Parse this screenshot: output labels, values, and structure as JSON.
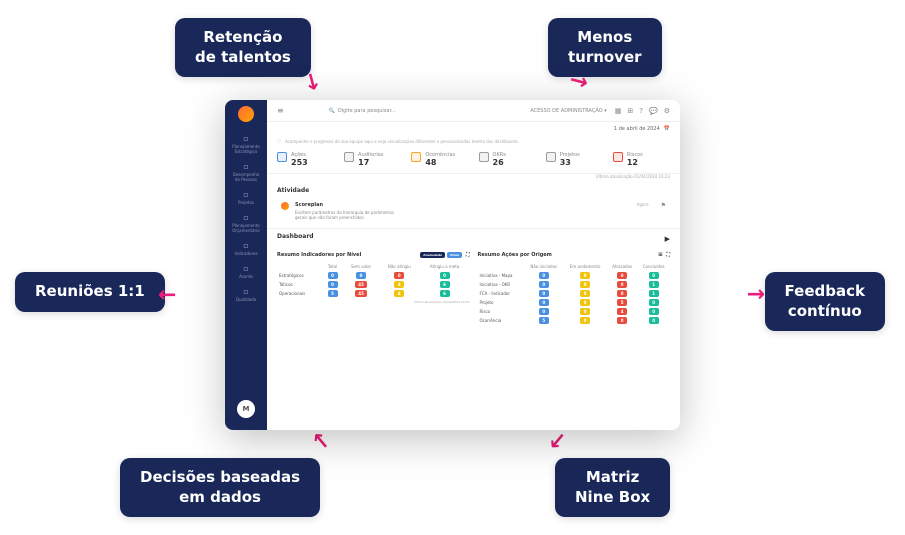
{
  "bubbles": {
    "retencao": "Retenção\nde talentos",
    "turnover": "Menos\nturnover",
    "reunioes": "Reuniões 1:1",
    "feedback": "Feedback\ncontínuo",
    "decisoes": "Decisões baseadas\nem dados",
    "matriz": "Matriz\nNine Box"
  },
  "topbar": {
    "search_placeholder": "Digite para pesquisar...",
    "admin_label": "ACESSO DE ADMINISTRAÇÃO"
  },
  "date": "1 de abril de 2024",
  "hint": "Acompanhe o progresso da sua equipe aqui e veja visualizações diferentes e personalizadas dentro dos dashboards.",
  "sidebar": {
    "items": [
      {
        "label": "Planejamento Estratégico"
      },
      {
        "label": "Desempenho de Pessoas"
      },
      {
        "label": "Projetos"
      },
      {
        "label": "Planejamento Orçamentário"
      },
      {
        "label": "Indicadores"
      },
      {
        "label": "Acordo"
      },
      {
        "label": "Qualidade"
      }
    ],
    "avatar": "M"
  },
  "stats": [
    {
      "label": "Ações",
      "value": "253",
      "color": "#4a90e2"
    },
    {
      "label": "Auditorias",
      "value": "17",
      "color": "#9b9b9b"
    },
    {
      "label": "Ocorrências",
      "value": "48",
      "color": "#f5a623"
    },
    {
      "label": "OKRs",
      "value": "26",
      "color": "#9b9b9b"
    },
    {
      "label": "Projetos",
      "value": "33",
      "color": "#9b9b9b"
    },
    {
      "label": "Riscos",
      "value": "12",
      "color": "#e74c3c"
    }
  ],
  "last_update": "Última atualização 01/04/2024 10:23",
  "activity_title": "Atividade",
  "activity": {
    "name": "Scoreplan",
    "time": "Agora",
    "desc": "Existem parâmetros da hierarquia de parâmetros gerais que não foram preenchidos"
  },
  "dashboard_title": "Dashboard",
  "indicadores": {
    "title": "Resumo Indicadores por Nível",
    "pills": [
      "Acumulado",
      "Atual"
    ],
    "cols": [
      "",
      "Total",
      "Sem valor",
      "Não atingiu",
      "Atingiu a meta"
    ],
    "rows": [
      {
        "label": "Estratégicos",
        "cells": [
          {
            "v": "0",
            "c": "c-blue"
          },
          {
            "v": "0",
            "c": "c-blue"
          },
          {
            "v": "0",
            "c": "c-red"
          },
          {
            "v": "0",
            "c": "c-teal"
          }
        ]
      },
      {
        "label": "Táticos",
        "cells": [
          {
            "v": "0",
            "c": "c-blue"
          },
          {
            "v": "45",
            "c": "c-red"
          },
          {
            "v": "4",
            "c": "c-yellow"
          },
          {
            "v": "6",
            "c": "c-teal"
          }
        ]
      },
      {
        "label": "Operacionais",
        "cells": [
          {
            "v": "5",
            "c": "c-blue"
          },
          {
            "v": "45",
            "c": "c-red"
          },
          {
            "v": "4",
            "c": "c-yellow"
          },
          {
            "v": "6",
            "c": "c-teal"
          }
        ]
      }
    ],
    "footer": "Última atualização 01/04/2024 10:23"
  },
  "origem": {
    "title": "Resumo Ações por Origem",
    "cols": [
      "",
      "Não iniciados",
      "Em andamento",
      "Atrasados",
      "Concluídos"
    ],
    "rows": [
      {
        "label": "Iniciativa - Mapa",
        "cells": [
          {
            "v": "0",
            "c": "c-blue"
          },
          {
            "v": "0",
            "c": "c-yellow"
          },
          {
            "v": "0",
            "c": "c-red"
          },
          {
            "v": "0",
            "c": "c-teal"
          }
        ]
      },
      {
        "label": "Iniciativa - OKR",
        "cells": [
          {
            "v": "0",
            "c": "c-blue"
          },
          {
            "v": "0",
            "c": "c-yellow"
          },
          {
            "v": "0",
            "c": "c-red"
          },
          {
            "v": "1",
            "c": "c-teal"
          }
        ]
      },
      {
        "label": "FCA - Indicador",
        "cells": [
          {
            "v": "0",
            "c": "c-blue"
          },
          {
            "v": "0",
            "c": "c-yellow"
          },
          {
            "v": "0",
            "c": "c-red"
          },
          {
            "v": "1",
            "c": "c-teal"
          }
        ]
      },
      {
        "label": "Projeto",
        "cells": [
          {
            "v": "0",
            "c": "c-blue"
          },
          {
            "v": "0",
            "c": "c-yellow"
          },
          {
            "v": "5",
            "c": "c-red"
          },
          {
            "v": "0",
            "c": "c-teal"
          }
        ]
      },
      {
        "label": "Risco",
        "cells": [
          {
            "v": "0",
            "c": "c-blue"
          },
          {
            "v": "0",
            "c": "c-yellow"
          },
          {
            "v": "4",
            "c": "c-red"
          },
          {
            "v": "0",
            "c": "c-teal"
          }
        ]
      },
      {
        "label": "Ocorrência",
        "cells": [
          {
            "v": "5",
            "c": "c-blue"
          },
          {
            "v": "0",
            "c": "c-yellow"
          },
          {
            "v": "0",
            "c": "c-red"
          },
          {
            "v": "0",
            "c": "c-teal"
          }
        ]
      }
    ]
  }
}
